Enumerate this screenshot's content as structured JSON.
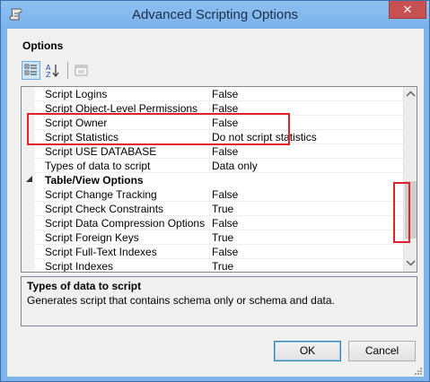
{
  "window": {
    "title": "Advanced Scripting Options",
    "close_label": "✕"
  },
  "options": {
    "heading": "Options"
  },
  "toolbar": {
    "categorized_icon": "categorized-view-icon",
    "alphabetical_icon": "alphabetical-sort-icon",
    "property_pages_icon": "property-pages-icon"
  },
  "grid": {
    "rows": [
      {
        "type": "prop",
        "name": "Script Logins",
        "value": "False"
      },
      {
        "type": "prop",
        "name": "Script Object-Level Permissions",
        "value": "False"
      },
      {
        "type": "prop",
        "name": "Script Owner",
        "value": "False"
      },
      {
        "type": "prop",
        "name": "Script Statistics",
        "value": "Do not script statistics"
      },
      {
        "type": "prop",
        "name": "Script USE DATABASE",
        "value": "False"
      },
      {
        "type": "prop",
        "name": "Types of data to script",
        "value": "Data only"
      },
      {
        "type": "category",
        "name": "Table/View Options"
      },
      {
        "type": "prop",
        "name": "Script Change Tracking",
        "value": "False"
      },
      {
        "type": "prop",
        "name": "Script Check Constraints",
        "value": "True"
      },
      {
        "type": "prop",
        "name": "Script Data Compression Options",
        "value": "False"
      },
      {
        "type": "prop",
        "name": "Script Foreign Keys",
        "value": "True"
      },
      {
        "type": "prop",
        "name": "Script Full-Text Indexes",
        "value": "False"
      },
      {
        "type": "prop",
        "name": "Script Indexes",
        "value": "True"
      }
    ]
  },
  "description": {
    "title": "Types of data to script",
    "text": "Generates script that contains schema only or schema and data."
  },
  "buttons": {
    "ok": "OK",
    "cancel": "Cancel"
  },
  "colors": {
    "highlight": "#e0202a",
    "title_bar": "#7eb4ea",
    "close_button": "#c75050"
  }
}
